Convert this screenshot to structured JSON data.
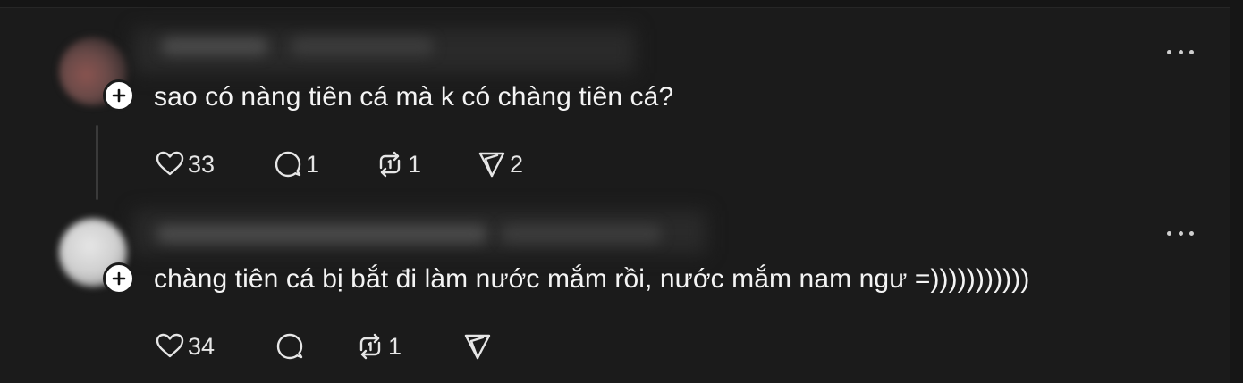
{
  "comments": [
    {
      "text": "sao có nàng tiên cá mà k có chàng tiên cá?",
      "likes": "33",
      "replies": "1",
      "reposts": "1",
      "shares": "2"
    },
    {
      "text": "chàng tiên cá bị bắt đi làm nước mắm rồi, nước mắm nam ngư =)))))))))))",
      "likes": "34",
      "replies": "",
      "reposts": "1",
      "shares": ""
    }
  ],
  "icons": {
    "like": "heart-icon",
    "reply": "comment-bubble-icon",
    "repost": "repost-icon",
    "share": "send-icon",
    "more": "more-horizontal-icon",
    "follow": "plus-icon"
  },
  "colors": {
    "background": "#1b1b1b",
    "text": "#f4f4f4",
    "icon": "#e6e6e6",
    "thread_line": "#3a3a3a",
    "badge": "#ffffff"
  }
}
